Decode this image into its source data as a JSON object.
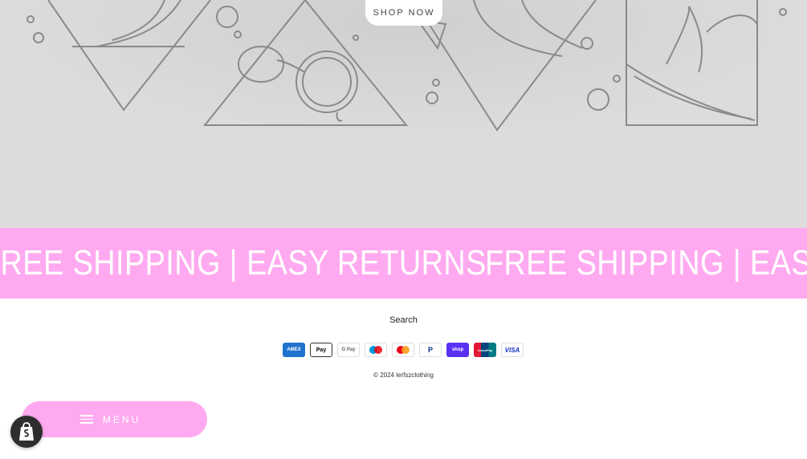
{
  "hero": {
    "shop_button_label": "SHOP NOW"
  },
  "announcement": {
    "text": "FREE SHIPPING | EASY RETURNS",
    "background": "#ffaaf0",
    "text_color": "#ffffff"
  },
  "footer": {
    "search_link": "Search",
    "payment_methods": [
      {
        "icon": "amex-icon",
        "label": "AMEX"
      },
      {
        "icon": "apple-pay-icon",
        "label": "Pay"
      },
      {
        "icon": "google-pay-icon",
        "label": "G Pay"
      },
      {
        "icon": "maestro-icon",
        "label": ""
      },
      {
        "icon": "mastercard-icon",
        "label": ""
      },
      {
        "icon": "paypal-icon",
        "label": "P"
      },
      {
        "icon": "shop-pay-icon",
        "label": "shop"
      },
      {
        "icon": "unionpay-icon",
        "label": "UnionPay"
      },
      {
        "icon": "visa-icon",
        "label": "VISA"
      }
    ],
    "copyright": "© 2024 lerfszclothing"
  },
  "menu_bar": {
    "label": "MENU",
    "background": "#ffaaf0"
  },
  "shopify_badge": {
    "icon": "shopify-bag-icon"
  }
}
